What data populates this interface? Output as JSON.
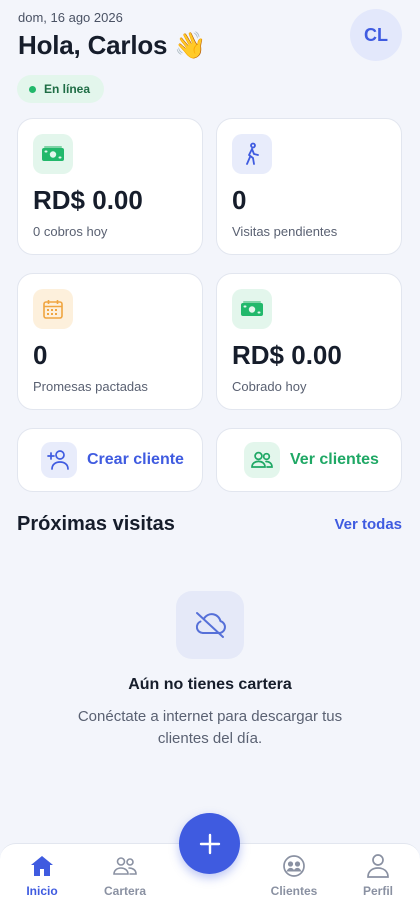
{
  "header": {
    "date": "dom, 16 ago 2026",
    "greeting": "Hola, Carlos 👋",
    "avatar_initials": "CL"
  },
  "status": {
    "label": "En línea",
    "color": "#22b86b"
  },
  "stats": [
    {
      "value": "RD$ 0.00",
      "label": "0 cobros hoy",
      "icon": "money-icon",
      "color": "#22b86b"
    },
    {
      "value": "0",
      "label": "Visitas pendientes",
      "icon": "walking-person-icon",
      "color": "#3f5be0"
    },
    {
      "value": "0",
      "label": "Promesas pactadas",
      "icon": "calendar-icon",
      "color": "#f0a540"
    },
    {
      "value": "RD$ 0.00",
      "label": "Cobrado hoy",
      "icon": "money-icon",
      "color": "#22b86b"
    }
  ],
  "actions": [
    {
      "label": "Crear cliente",
      "icon": "add-user-icon",
      "color": "#3f5be0"
    },
    {
      "label": "Ver clientes",
      "icon": "users-icon",
      "color": "#1fa865"
    }
  ],
  "upcoming": {
    "title": "Próximas visitas",
    "see_all": "Ver todas",
    "empty_title": "Aún no tienes cartera",
    "empty_text": "Conéctate a internet para descargar tus clientes del día.",
    "empty_icon": "cloud-off-icon"
  },
  "nav": {
    "items": [
      {
        "label": "Inicio",
        "icon": "home-icon",
        "active": true
      },
      {
        "label": "Cartera",
        "icon": "people-icon",
        "active": false
      },
      {
        "label": "Clientes",
        "icon": "clients-icon",
        "active": false
      },
      {
        "label": "Perfil",
        "icon": "profile-icon",
        "active": false
      }
    ],
    "fab_icon": "plus-icon"
  },
  "colors": {
    "accent": "#3f5be0",
    "success": "#22b86b",
    "background": "#f3f5fb"
  }
}
